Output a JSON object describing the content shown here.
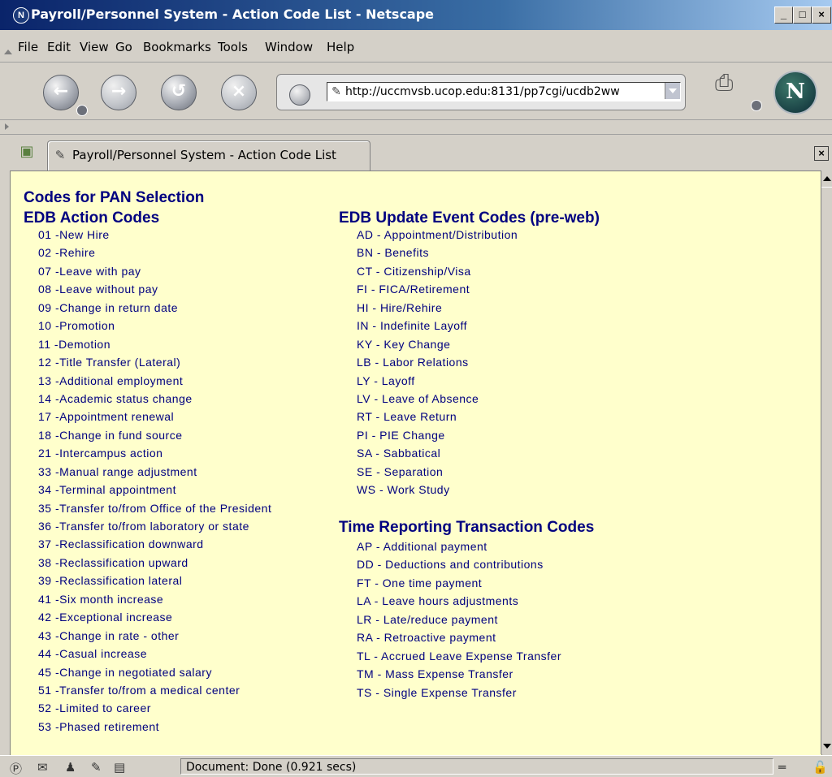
{
  "window": {
    "title": "Payroll/Personnel System - Action Code List - Netscape",
    "app_icon": "netscape-icon",
    "controls": [
      "_",
      "□",
      "×"
    ]
  },
  "menubar": {
    "items": [
      "File",
      "Edit",
      "View",
      "Go",
      "Bookmarks",
      "Tools",
      "Window",
      "Help"
    ]
  },
  "toolbar": {
    "back_icon": "back-arrow-icon",
    "forward_icon": "forward-arrow-icon",
    "reload_icon": "reload-icon",
    "stop_icon": "stop-icon",
    "url": "http://uccmvsb.ucop.edu:8131/pp7cgi/ucdb2ww"
  },
  "tab": {
    "label": "Payroll/Personnel System - Action Code List"
  },
  "content": {
    "heading": "Codes for PAN Selection",
    "edb_action": {
      "title": "EDB Action Codes",
      "items": [
        "01 -New Hire",
        "02 -Rehire",
        "07 -Leave with pay",
        "08 -Leave without pay",
        "09 -Change in return date",
        "10 -Promotion",
        "11 -Demotion",
        "12 -Title Transfer (Lateral)",
        "13 -Additional employment",
        "14 -Academic status change",
        "17 -Appointment renewal",
        "18 -Change in fund source",
        "21 -Intercampus action",
        "33 -Manual range adjustment",
        "34 -Terminal appointment",
        "35 -Transfer to/from Office of the President",
        "36 -Transfer to/from laboratory or state",
        "37 -Reclassification downward",
        "38 -Reclassification upward",
        "39 -Reclassification lateral",
        "41 -Six month increase",
        "42 -Exceptional increase",
        "43 -Change in rate - other",
        "44 -Casual increase",
        "45 -Change in negotiated salary",
        "51 -Transfer to/from a medical center",
        "52 -Limited to career",
        "53 -Phased retirement"
      ]
    },
    "edb_update": {
      "title": "EDB Update Event Codes (pre-web)",
      "items": [
        "AD - Appointment/Distribution",
        "BN - Benefits",
        "CT - Citizenship/Visa",
        "FI - FICA/Retirement",
        "HI - Hire/Rehire",
        "IN - Indefinite Layoff",
        "KY - Key Change",
        "LB - Labor Relations",
        "LY - Layoff",
        "LV - Leave of Absence",
        "RT - Leave Return",
        "PI - PIE Change",
        "SA - Sabbatical",
        "SE - Separation",
        "WS - Work Study"
      ]
    },
    "time_reporting": {
      "title": "Time Reporting Transaction Codes",
      "items": [
        "AP - Additional payment",
        "DD - Deductions and contributions",
        "FT - One time payment",
        "LA - Leave hours adjustments",
        "LR - Late/reduce payment",
        "RA - Retroactive payment",
        "TL - Accrued Leave Expense Transfer",
        "TM - Mass Expense Transfer",
        "TS - Single Expense Transfer"
      ]
    }
  },
  "statusbar": {
    "text": "Document: Done (0.921 secs)"
  }
}
